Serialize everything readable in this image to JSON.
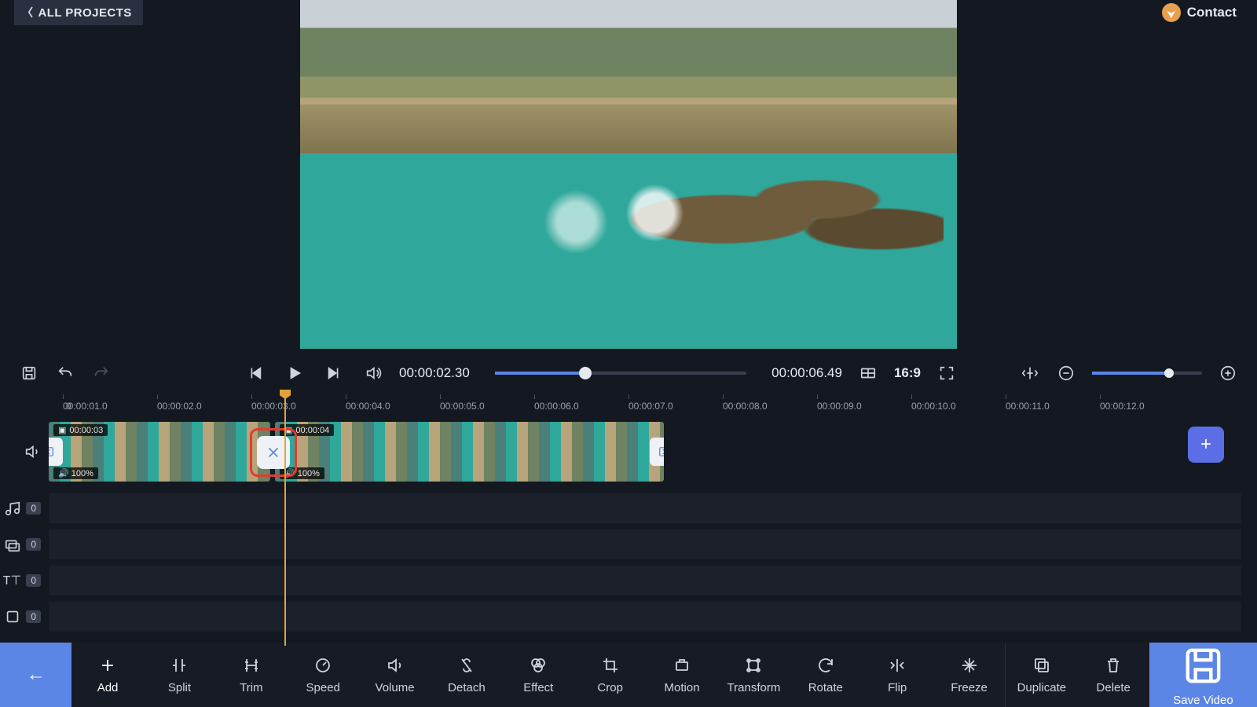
{
  "header": {
    "all_projects": "ALL PROJECTS",
    "contact": "Contact"
  },
  "player": {
    "current_time": "00:00:02.30",
    "total_time": "00:00:06.49",
    "aspect_ratio": "16:9"
  },
  "ruler": {
    "start": "0",
    "ticks": [
      "00:00:01.0",
      "00:00:02.0",
      "00:00:03.0",
      "00:00:04.0",
      "00:00:05.0",
      "00:00:06.0",
      "00:00:07.0",
      "00:00:08.0",
      "00:00:09.0",
      "00:00:10.0",
      "00:00:11.0",
      "00:00:12.0"
    ]
  },
  "clips": {
    "clip1_duration": "00:00:03",
    "clip1_volume": "100%",
    "clip2_duration": "00:00:04",
    "clip2_volume": "100%"
  },
  "tracks": {
    "audio_count": "0",
    "overlay_count": "0",
    "text_count": "0",
    "element_count": "0"
  },
  "tools": {
    "add": "Add",
    "split": "Split",
    "trim": "Trim",
    "speed": "Speed",
    "volume": "Volume",
    "detach": "Detach",
    "effect": "Effect",
    "crop": "Crop",
    "motion": "Motion",
    "transform": "Transform",
    "rotate": "Rotate",
    "flip": "Flip",
    "freeze": "Freeze",
    "duplicate": "Duplicate",
    "delete": "Delete",
    "save": "Save Video"
  }
}
